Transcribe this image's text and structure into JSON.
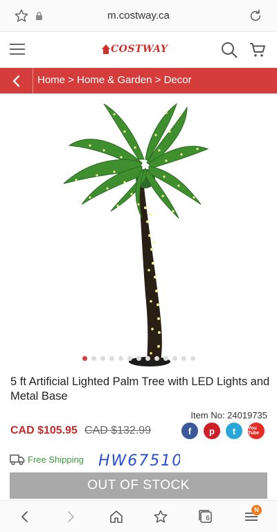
{
  "browser": {
    "url": "m.costway.ca",
    "tab_count": "6",
    "menu_badge": "N"
  },
  "header": {
    "logo_text": "COSTWAY"
  },
  "breadcrumb": {
    "text": "Home > Home & Garden > Decor"
  },
  "gallery": {
    "slide_count": 13,
    "active_slide": 0
  },
  "product": {
    "title": "5 ft Artificial Lighted Palm Tree with LED Lights and Metal Base",
    "item_no": "Item No: 24019735",
    "price": "CAD $105.95",
    "old_price": "CAD $132.99",
    "shipping": "Free Shipping",
    "handwritten_note": "HW67510",
    "stock_button": "OUT OF STOCK"
  },
  "social": {
    "facebook": "f",
    "pinterest": "p",
    "twitter": "t",
    "youtube": "You Tube"
  },
  "colors": {
    "brand_red": "#d53d3d",
    "price_red": "#c62b2b",
    "shipping_green": "#3c9a3c",
    "button_gray": "#a9a9a9"
  }
}
